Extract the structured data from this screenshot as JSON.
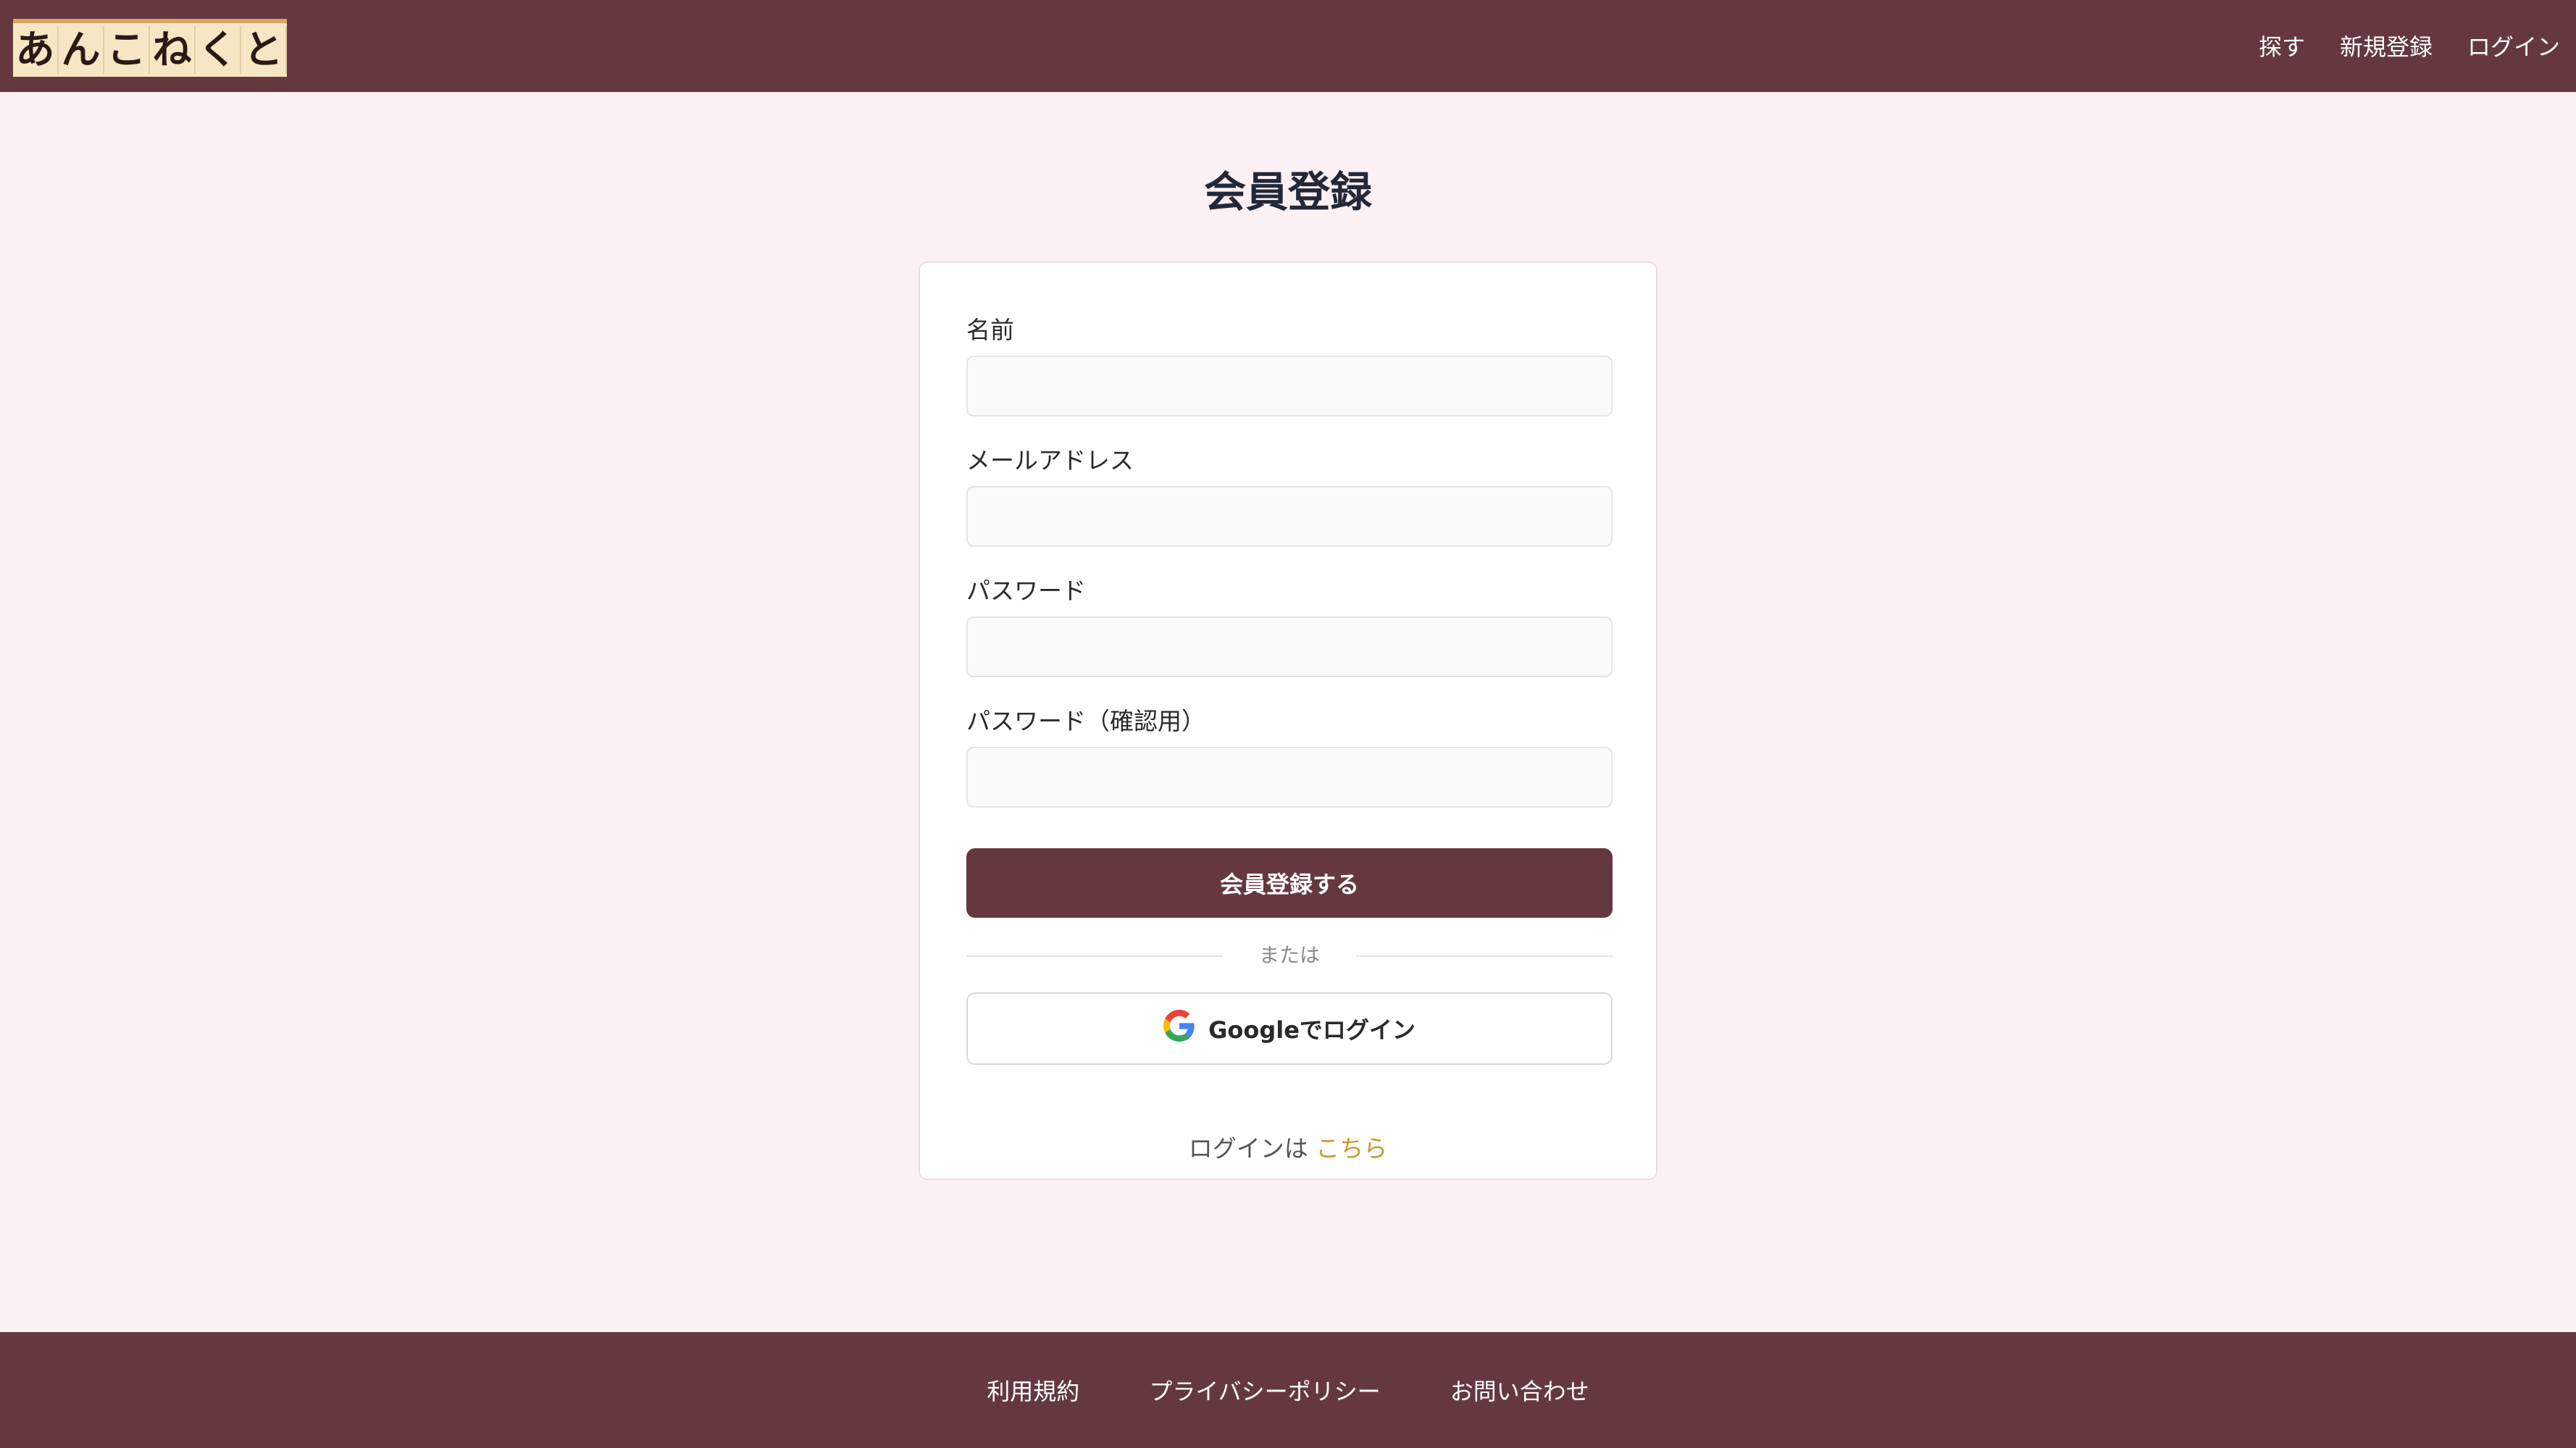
{
  "header": {
    "logo_chars": [
      "あ",
      "ん",
      "こ",
      "ね",
      "く",
      "と"
    ],
    "nav": [
      "探す",
      "新規登録",
      "ログイン"
    ]
  },
  "page": {
    "title": "会員登録"
  },
  "form": {
    "name_label": "名前",
    "email_label": "メールアドレス",
    "password_label": "パスワード",
    "password_confirm_label": "パスワード（確認用）",
    "submit_label": "会員登録する",
    "divider_text": "または",
    "google_label": "Googleでログイン",
    "login_prompt": "ログインは",
    "login_link": "こちら"
  },
  "footer": {
    "links": [
      "利用規約",
      "プライバシーポリシー",
      "お問い合わせ"
    ]
  },
  "colors": {
    "brand": "#653840",
    "background": "#fbf0f3",
    "link_accent": "#c99a2e"
  },
  "icons": [
    "google-icon"
  ]
}
